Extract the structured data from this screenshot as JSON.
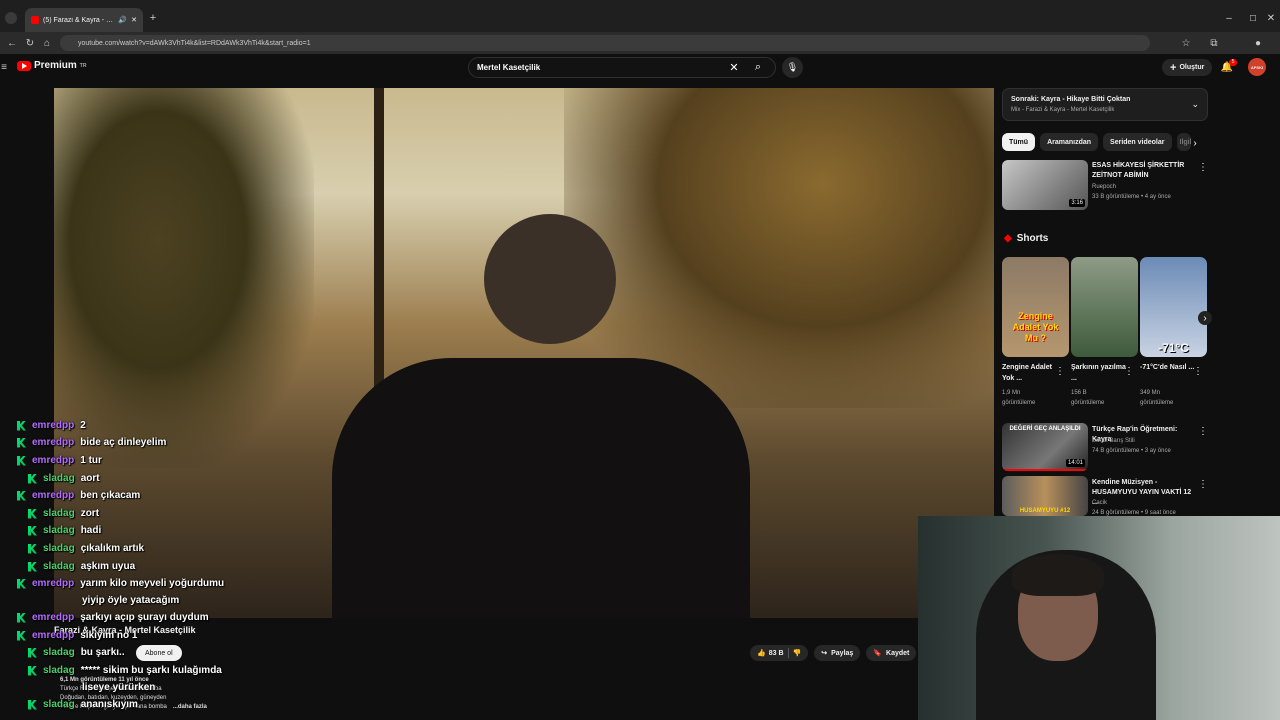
{
  "browser": {
    "tab_title": "(5) Farazi & Kayra - Mertel...",
    "url": "youtube.com/watch?v=dAWk3VhTi4k&list=RDdAWk3VhTi4k&start_radio=1"
  },
  "youtube": {
    "logo": "Premium",
    "logo_badge": "TR",
    "search_query": "Mertel Kasetçilik",
    "create_label": "Oluştur",
    "notif_count": "5",
    "avatar_text": "APSKI"
  },
  "video": {
    "title": "Farazi & Kayra - Mertel Kasetçilik",
    "subscribe": "Abone ol",
    "likes": "83 B",
    "share": "Paylaş",
    "save": "Kaydet",
    "views_line": "6,1 Mn görüntüleme  11 yıl önce",
    "desc_lines": [
      "Türkçe Rap'in gelişen efsanesi bomba",
      "Doğudan, batıdan, kuzeyden, güneyden",
      "Türkçe Rap'e el geliyor işte kana bomba"
    ],
    "more": "...daha fazla"
  },
  "upnext": {
    "title": "Sonraki: Kayra - Hikaye Bitti Çoktan",
    "subtitle": "Mix - Farazi & Kayra - Mertel Kasetçilik"
  },
  "chips": [
    "Tümü",
    "Aramanızdan",
    "Seriden videolar",
    "Ilgili"
  ],
  "video1": {
    "title": "ESAS HİKAYESİ ŞİRKETTİR ZEİTNOT ABİMİN",
    "channel": "Ruepoch",
    "stats": "33 B görüntüleme • 4 ay önce",
    "duration": "3:16"
  },
  "shorts": {
    "heading": "Shorts",
    "items": [
      {
        "title": "Zengine Adalet Yok ...",
        "views": "1,9 Mn",
        "views2": "görüntüleme",
        "caption": "Zengine Adalet Yok Mu ?"
      },
      {
        "title": "Şarkının yazılma ...",
        "views": "156 B",
        "views2": "görüntüleme",
        "caption": ""
      },
      {
        "title": "-71°C'de Nasıl ...",
        "views": "349 Mn",
        "views2": "görüntüleme",
        "caption": "-71°C"
      }
    ]
  },
  "video2": {
    "title": "Türkçe Rap'in Öğretmeni: Kayra",
    "channel": "Burak Barış Stili",
    "stats": "74 B görüntüleme • 3 ay önce",
    "duration": "14:01",
    "thumb_text": "DEĞERİ GEÇ ANLAŞILDI"
  },
  "video3": {
    "title": "Kendine Müzisyen - HUSAMYUYU YAYIN VAKTİ 12 ...",
    "channel": "Cacik",
    "stats": "24 B görüntüleme • 9 saat önce",
    "thumb_text": "HUSAMYUYU #12"
  },
  "chat": [
    {
      "user": "emredpp",
      "text": "2"
    },
    {
      "user": "emredpp",
      "text": "bide aç dinleyelim"
    },
    {
      "user": "emredpp",
      "text": "1 tur"
    },
    {
      "user": "sladag",
      "text": "aort"
    },
    {
      "user": "emredpp",
      "text": "ben çıkacam"
    },
    {
      "user": "sladag",
      "text": "zort"
    },
    {
      "user": "sladag",
      "text": "hadi"
    },
    {
      "user": "sladag",
      "text": "çıkalıkm artık"
    },
    {
      "user": "sladag",
      "text": "aşkım uyua"
    },
    {
      "user": "emredpp",
      "text": "yarım kilo meyveli yoğurdumu"
    },
    {
      "user": "",
      "text": "yiyip öyle yatacağım"
    },
    {
      "user": "emredpp",
      "text": "şarkıyı açıp şurayı duydum"
    },
    {
      "user": "emredpp",
      "text": "sikiyim no 1"
    },
    {
      "user": "sladag",
      "text": "bu şarkı.."
    },
    {
      "user": "sladag",
      "text": "***** sikim bu şarkı kulağımda"
    },
    {
      "user": "",
      "text": "liseye yürürken"
    },
    {
      "user": "sladag",
      "text": "ananıskıyım"
    }
  ],
  "colors": {
    "emredpp": "#b36bff",
    "sladag": "#4ed16b",
    "kick": "#00e676",
    "yt_red": "#ff0000"
  }
}
